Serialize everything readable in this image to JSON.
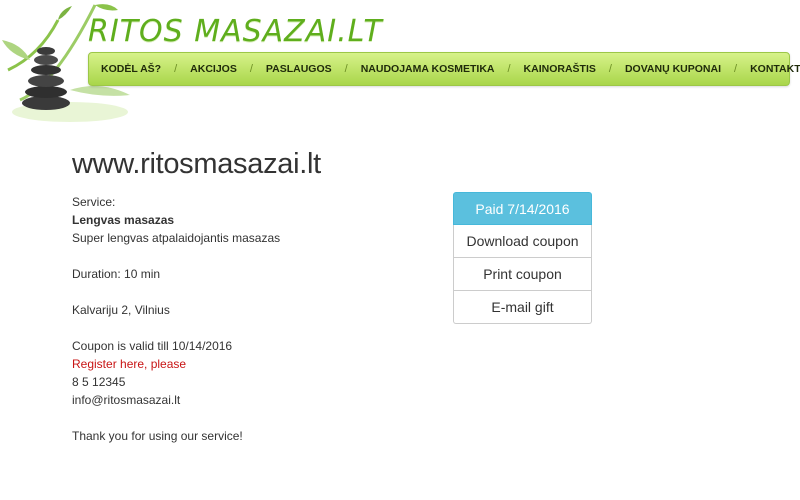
{
  "brand": {
    "name": "RITOS MASAZAI.LT"
  },
  "nav": {
    "items": [
      {
        "label": "KODĖL AŠ?"
      },
      {
        "label": "AKCIJOS"
      },
      {
        "label": "PASLAUGOS"
      },
      {
        "label": "NAUDOJAMA KOSMETIKA"
      },
      {
        "label": "KAINORAŠTIS"
      },
      {
        "label": "DOVANŲ KUPONAI"
      },
      {
        "label": "KONTAKTAI"
      }
    ],
    "separator": "/"
  },
  "main": {
    "title": "www.ritosmasazai.lt",
    "service_label": "Service:",
    "service_name": "Lengvas masazas",
    "service_desc": "Super lengvas atpalaidojantis masazas",
    "duration": "Duration: 10 min",
    "address": "Kalvariju 2, Vilnius",
    "validity": "Coupon is valid till 10/14/2016",
    "register_link": "Register here, please",
    "phone": "8 5 12345",
    "email": "info@ritosmasazai.lt",
    "thanks": "Thank you for using our service!"
  },
  "actions": {
    "paid": "Paid 7/14/2016",
    "download": "Download coupon",
    "print": "Print coupon",
    "email_gift": "E-mail gift"
  },
  "colors": {
    "brand_green": "#5fae1d",
    "nav_top": "#d7f28a",
    "nav_bottom": "#a9d64a",
    "paid_bg": "#5bc0de",
    "link_red": "#c81414"
  },
  "icons": {
    "logo": "stone-stack-bamboo-logo-icon"
  }
}
